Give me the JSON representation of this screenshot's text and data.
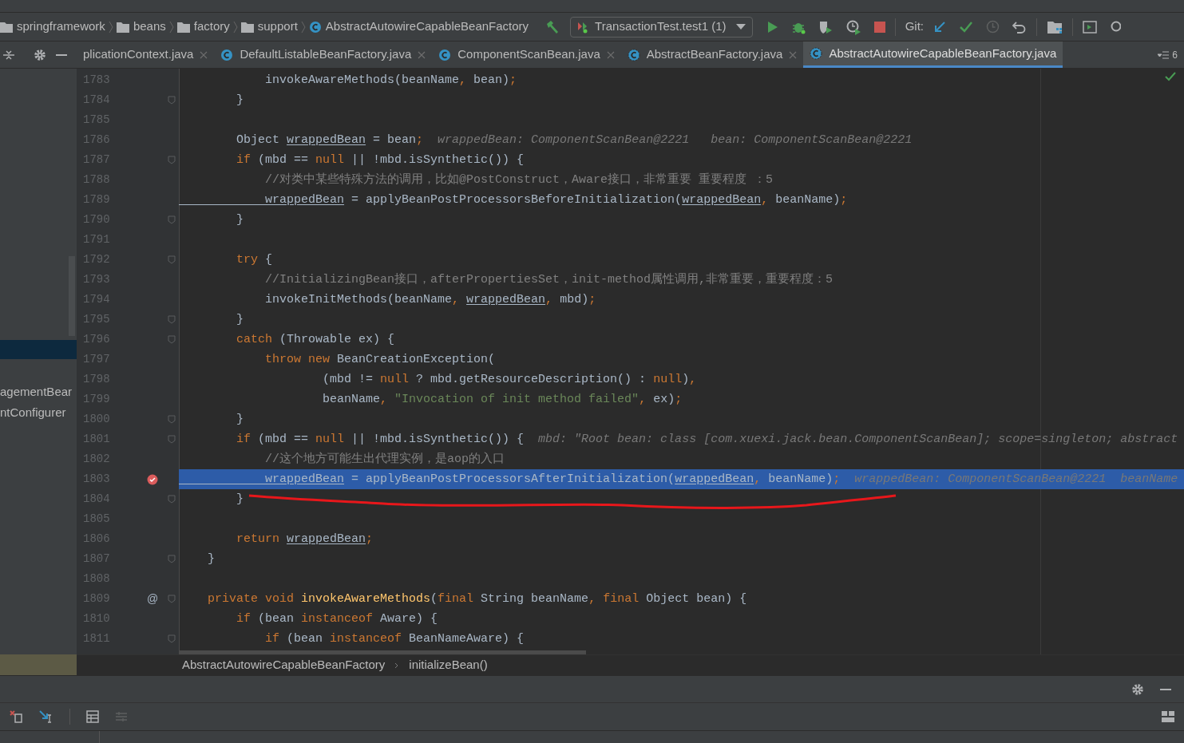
{
  "nav_bar": {
    "crumbs": [
      {
        "kind": "folder",
        "label": "springframework"
      },
      {
        "kind": "folder",
        "label": "beans"
      },
      {
        "kind": "folder",
        "label": "factory"
      },
      {
        "kind": "folder",
        "label": "support"
      },
      {
        "kind": "class",
        "label": "AbstractAutowireCapableBeanFactory"
      }
    ],
    "run_config": "TransactionTest.test1 (1)",
    "git_label": "Git:"
  },
  "project_panel": {
    "items": [
      {
        "label": "agementBear",
        "selected": false
      },
      {
        "label": "ntConfigurer",
        "selected": false
      }
    ]
  },
  "tabs": [
    {
      "label": "plicationContext.java",
      "kind": "plain",
      "selected": false
    },
    {
      "label": "DefaultListableBeanFactory.java",
      "kind": "class",
      "selected": false
    },
    {
      "label": "ComponentScanBean.java",
      "kind": "class",
      "selected": false
    },
    {
      "label": "AbstractBeanFactory.java",
      "kind": "abstract",
      "selected": false
    },
    {
      "label": "AbstractAutowireCapableBeanFactory.java",
      "kind": "abstract",
      "selected": true
    }
  ],
  "tab_overflow": "6",
  "editor": {
    "lines": [
      {
        "number": "1783",
        "current": false,
        "fold": false,
        "tokens": [
          {
            "kind": "plain",
            "text": "            invokeAwareMethods(beanName"
          },
          {
            "kind": "keyword",
            "text": ", "
          },
          {
            "kind": "plain",
            "text": "bean)"
          },
          {
            "kind": "keyword",
            "text": ";"
          }
        ]
      },
      {
        "number": "1784",
        "current": false,
        "fold": true,
        "tokens": [
          {
            "kind": "plain",
            "text": "        }"
          }
        ]
      },
      {
        "number": "1785",
        "current": false,
        "fold": false
      },
      {
        "number": "1786",
        "current": false,
        "fold": false,
        "tokens": [
          {
            "kind": "plain",
            "text": "        Object "
          },
          {
            "kind": "variable",
            "text": "wrappedBean"
          },
          {
            "kind": "plain",
            "text": " = bean"
          },
          {
            "kind": "keyword",
            "text": ";"
          },
          {
            "kind": "hint",
            "text": "  wrappedBean: ComponentScanBean@2221   bean: ComponentScanBean@2221"
          }
        ]
      },
      {
        "number": "1787",
        "current": false,
        "fold": true,
        "tokens": [
          {
            "kind": "keyword",
            "text": "        if"
          },
          {
            "kind": "plain",
            "text": " (mbd == "
          },
          {
            "kind": "keyword",
            "text": "null"
          },
          {
            "kind": "plain",
            "text": " || !mbd.isSynthetic()) {"
          }
        ]
      },
      {
        "number": "1788",
        "current": false,
        "fold": false,
        "tokens": [
          {
            "kind": "comment",
            "text": "            //对类中某些特殊方法的调用，比如@PostConstruct，Aware接口，非常重要 重要程度 ：5"
          }
        ]
      },
      {
        "number": "1789",
        "current": false,
        "fold": false,
        "tokens": [
          {
            "kind": "variable",
            "text": "            wrappedBean"
          },
          {
            "kind": "plain",
            "text": " = applyBeanPostProcessorsBeforeInitialization("
          },
          {
            "kind": "variable",
            "text": "wrappedBean"
          },
          {
            "kind": "keyword",
            "text": ", "
          },
          {
            "kind": "plain",
            "text": "beanName)"
          },
          {
            "kind": "keyword",
            "text": ";"
          }
        ]
      },
      {
        "number": "1790",
        "current": false,
        "fold": true,
        "tokens": [
          {
            "kind": "plain",
            "text": "        }"
          }
        ]
      },
      {
        "number": "1791",
        "current": false,
        "fold": false
      },
      {
        "number": "1792",
        "current": false,
        "fold": true,
        "tokens": [
          {
            "kind": "keyword",
            "text": "        try"
          },
          {
            "kind": "plain",
            "text": " {"
          }
        ]
      },
      {
        "number": "1793",
        "current": false,
        "fold": false,
        "tokens": [
          {
            "kind": "comment",
            "text": "            //InitializingBean接口，afterPropertiesSet，init-method属性调用,非常重要，重要程度：5"
          }
        ]
      },
      {
        "number": "1794",
        "current": false,
        "fold": false,
        "tokens": [
          {
            "kind": "plain",
            "text": "            invokeInitMethods(beanName"
          },
          {
            "kind": "keyword",
            "text": ", "
          },
          {
            "kind": "variable",
            "text": "wrappedBean"
          },
          {
            "kind": "keyword",
            "text": ", "
          },
          {
            "kind": "plain",
            "text": "mbd)"
          },
          {
            "kind": "keyword",
            "text": ";"
          }
        ]
      },
      {
        "number": "1795",
        "current": false,
        "fold": true,
        "tokens": [
          {
            "kind": "plain",
            "text": "        }"
          }
        ]
      },
      {
        "number": "1796",
        "current": false,
        "fold": true,
        "tokens": [
          {
            "kind": "keyword",
            "text": "        catch"
          },
          {
            "kind": "plain",
            "text": " (Throwable ex) {"
          }
        ]
      },
      {
        "number": "1797",
        "current": false,
        "fold": false,
        "tokens": [
          {
            "kind": "keyword",
            "text": "            throw new"
          },
          {
            "kind": "plain",
            "text": " BeanCreationException("
          }
        ]
      },
      {
        "number": "1798",
        "current": false,
        "fold": false,
        "tokens": [
          {
            "kind": "plain",
            "text": "                    (mbd != "
          },
          {
            "kind": "keyword",
            "text": "null"
          },
          {
            "kind": "plain",
            "text": " ? mbd.getResourceDescription() : "
          },
          {
            "kind": "keyword",
            "text": "null"
          },
          {
            "kind": "plain",
            "text": ")"
          },
          {
            "kind": "keyword",
            "text": ","
          }
        ]
      },
      {
        "number": "1799",
        "current": false,
        "fold": false,
        "tokens": [
          {
            "kind": "plain",
            "text": "                    beanName"
          },
          {
            "kind": "keyword",
            "text": ", "
          },
          {
            "kind": "string",
            "text": "\"Invocation of init method failed\""
          },
          {
            "kind": "keyword",
            "text": ", "
          },
          {
            "kind": "plain",
            "text": "ex)"
          },
          {
            "kind": "keyword",
            "text": ";"
          }
        ]
      },
      {
        "number": "1800",
        "current": false,
        "fold": true,
        "tokens": [
          {
            "kind": "plain",
            "text": "        }"
          }
        ]
      },
      {
        "number": "1801",
        "current": false,
        "fold": true,
        "tokens": [
          {
            "kind": "keyword",
            "text": "        if"
          },
          {
            "kind": "plain",
            "text": " (mbd == "
          },
          {
            "kind": "keyword",
            "text": "null"
          },
          {
            "kind": "plain",
            "text": " || !mbd.isSynthetic()) {"
          },
          {
            "kind": "hint",
            "text": "  mbd: \"Root bean: class [com.xuexi.jack.bean.ComponentScanBean]; scope=singleton; abstract"
          }
        ]
      },
      {
        "number": "1802",
        "current": false,
        "fold": false,
        "tokens": [
          {
            "kind": "comment",
            "text": "            //这个地方可能生出代理实例，是aop的入口"
          }
        ]
      },
      {
        "number": "1803",
        "current": true,
        "fold": false,
        "breakpoint": true,
        "tokens": [
          {
            "kind": "variable",
            "text": "            wrappedBean"
          },
          {
            "kind": "plain",
            "text": " = applyBeanPostProcessorsAfterInitialization("
          },
          {
            "kind": "variable",
            "text": "wrappedBean"
          },
          {
            "kind": "keyword",
            "text": ", "
          },
          {
            "kind": "plain",
            "text": "beanName)"
          },
          {
            "kind": "keyword",
            "text": ";"
          },
          {
            "kind": "hint",
            "text": "  wrappedBean: ComponentScanBean@2221  beanName"
          }
        ]
      },
      {
        "number": "1804",
        "current": false,
        "fold": true,
        "tokens": [
          {
            "kind": "plain",
            "text": "        }"
          }
        ]
      },
      {
        "number": "1805",
        "current": false,
        "fold": false
      },
      {
        "number": "1806",
        "current": false,
        "fold": false,
        "tokens": [
          {
            "kind": "keyword",
            "text": "        return "
          },
          {
            "kind": "variable",
            "text": "wrappedBean"
          },
          {
            "kind": "keyword",
            "text": ";"
          }
        ]
      },
      {
        "number": "1807",
        "current": false,
        "fold": true,
        "tokens": [
          {
            "kind": "plain",
            "text": "    }"
          }
        ]
      },
      {
        "number": "1808",
        "current": false,
        "fold": false
      },
      {
        "number": "1809",
        "current": false,
        "fold": true,
        "mark": "@",
        "tokens": [
          {
            "kind": "keyword",
            "text": "    private void "
          },
          {
            "kind": "method",
            "text": "invokeAwareMethods"
          },
          {
            "kind": "plain",
            "text": "("
          },
          {
            "kind": "keyword",
            "text": "final "
          },
          {
            "kind": "plain",
            "text": "String beanName"
          },
          {
            "kind": "keyword",
            "text": ", final "
          },
          {
            "kind": "plain",
            "text": "Object bean) {"
          }
        ]
      },
      {
        "number": "1810",
        "current": false,
        "fold": false,
        "tokens": [
          {
            "kind": "keyword",
            "text": "        if"
          },
          {
            "kind": "plain",
            "text": " (bean "
          },
          {
            "kind": "keyword",
            "text": "instanceof"
          },
          {
            "kind": "plain",
            "text": " Aware) {"
          }
        ]
      },
      {
        "number": "1811",
        "current": false,
        "fold": true,
        "tokens": [
          {
            "kind": "keyword",
            "text": "            if"
          },
          {
            "kind": "plain",
            "text": " (bean "
          },
          {
            "kind": "keyword",
            "text": "instanceof"
          },
          {
            "kind": "plain",
            "text": " BeanNameAware) {"
          }
        ]
      }
    ]
  },
  "editor_breadcrumb": [
    "AbstractAutowireCapableBeanFactory",
    "initializeBean()"
  ]
}
